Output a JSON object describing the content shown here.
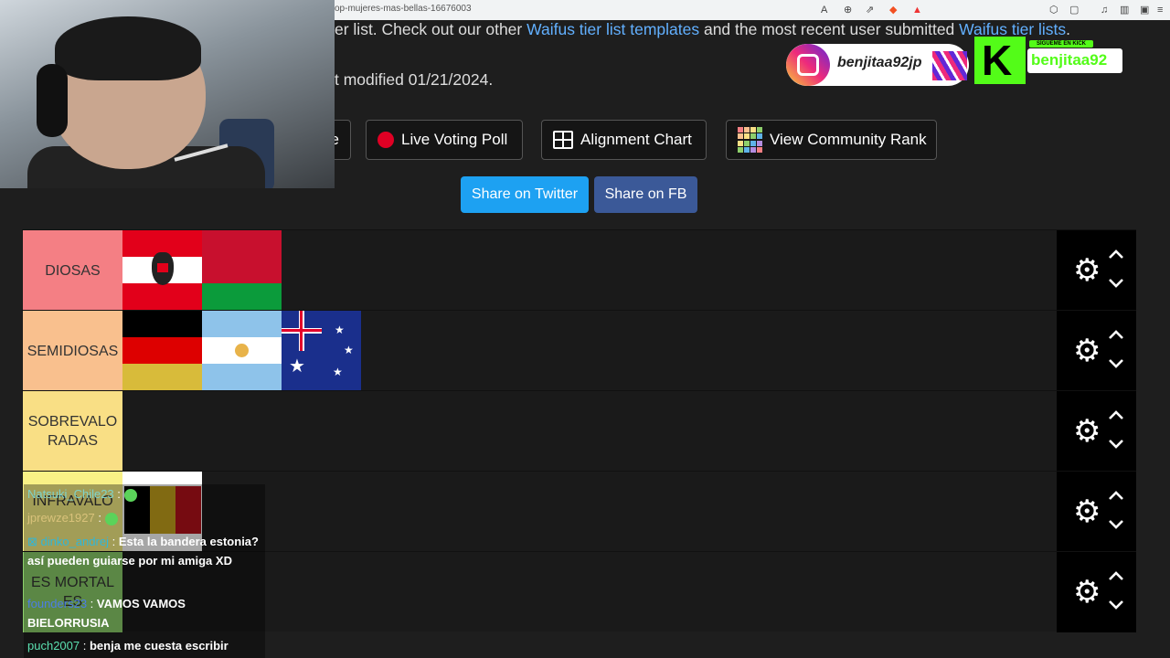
{
  "browser": {
    "url": "op-mujeres-mas-bellas-16676003"
  },
  "page": {
    "line1_prefix": "er list. Check out our other ",
    "line1_link1": "Waifus tier list templates",
    "line1_middle": " and the most recent user submitted ",
    "line1_link2": "Waifus tier lists",
    "line1_suffix": ".",
    "line2": "t modified 01/21/2024."
  },
  "actions": {
    "partial_button": "e",
    "live_voting": "Live Voting Poll",
    "alignment_chart": "Alignment Chart",
    "community_rank": "View Community Rank",
    "share_twitter": "Share on Twitter",
    "share_fb": "Share on FB"
  },
  "tiers": [
    {
      "label": "DIOSAS",
      "color": "#f47f84"
    },
    {
      "label": "SEMIDIOSAS",
      "color": "#f9c08e"
    },
    {
      "label": "SOBREVALORADAS",
      "color": "#f9df85"
    },
    {
      "label": "INFRAVALO",
      "color": "#f9f186"
    },
    {
      "label": "ES MORTALES",
      "color": "#8dcf6b"
    }
  ],
  "overlay": {
    "instagram_handle": "benjitaa92jp",
    "kick_small": "SÍGUEME EN KICK",
    "kick_handle": "benjitaa92"
  },
  "chat": [
    {
      "user": "Natsuki_Chile23",
      "user_color": "#7fd3c9",
      "text": ""
    },
    {
      "user": "jprewze1927",
      "user_color": "#d9c27a",
      "text": ""
    },
    {
      "user": "dinko_andrej",
      "user_color": "#2fb7d9",
      "text": "Esta la bandera estonia? así pueden guiarse por mi amiga XD"
    },
    {
      "user": "founders23",
      "user_color": "#4b7ee6",
      "text": "VAMOS VAMOS BIELORRUSIA"
    },
    {
      "user": "puch2007",
      "user_color": "#5be0b0",
      "text": "benja me cuesta escribir"
    }
  ]
}
